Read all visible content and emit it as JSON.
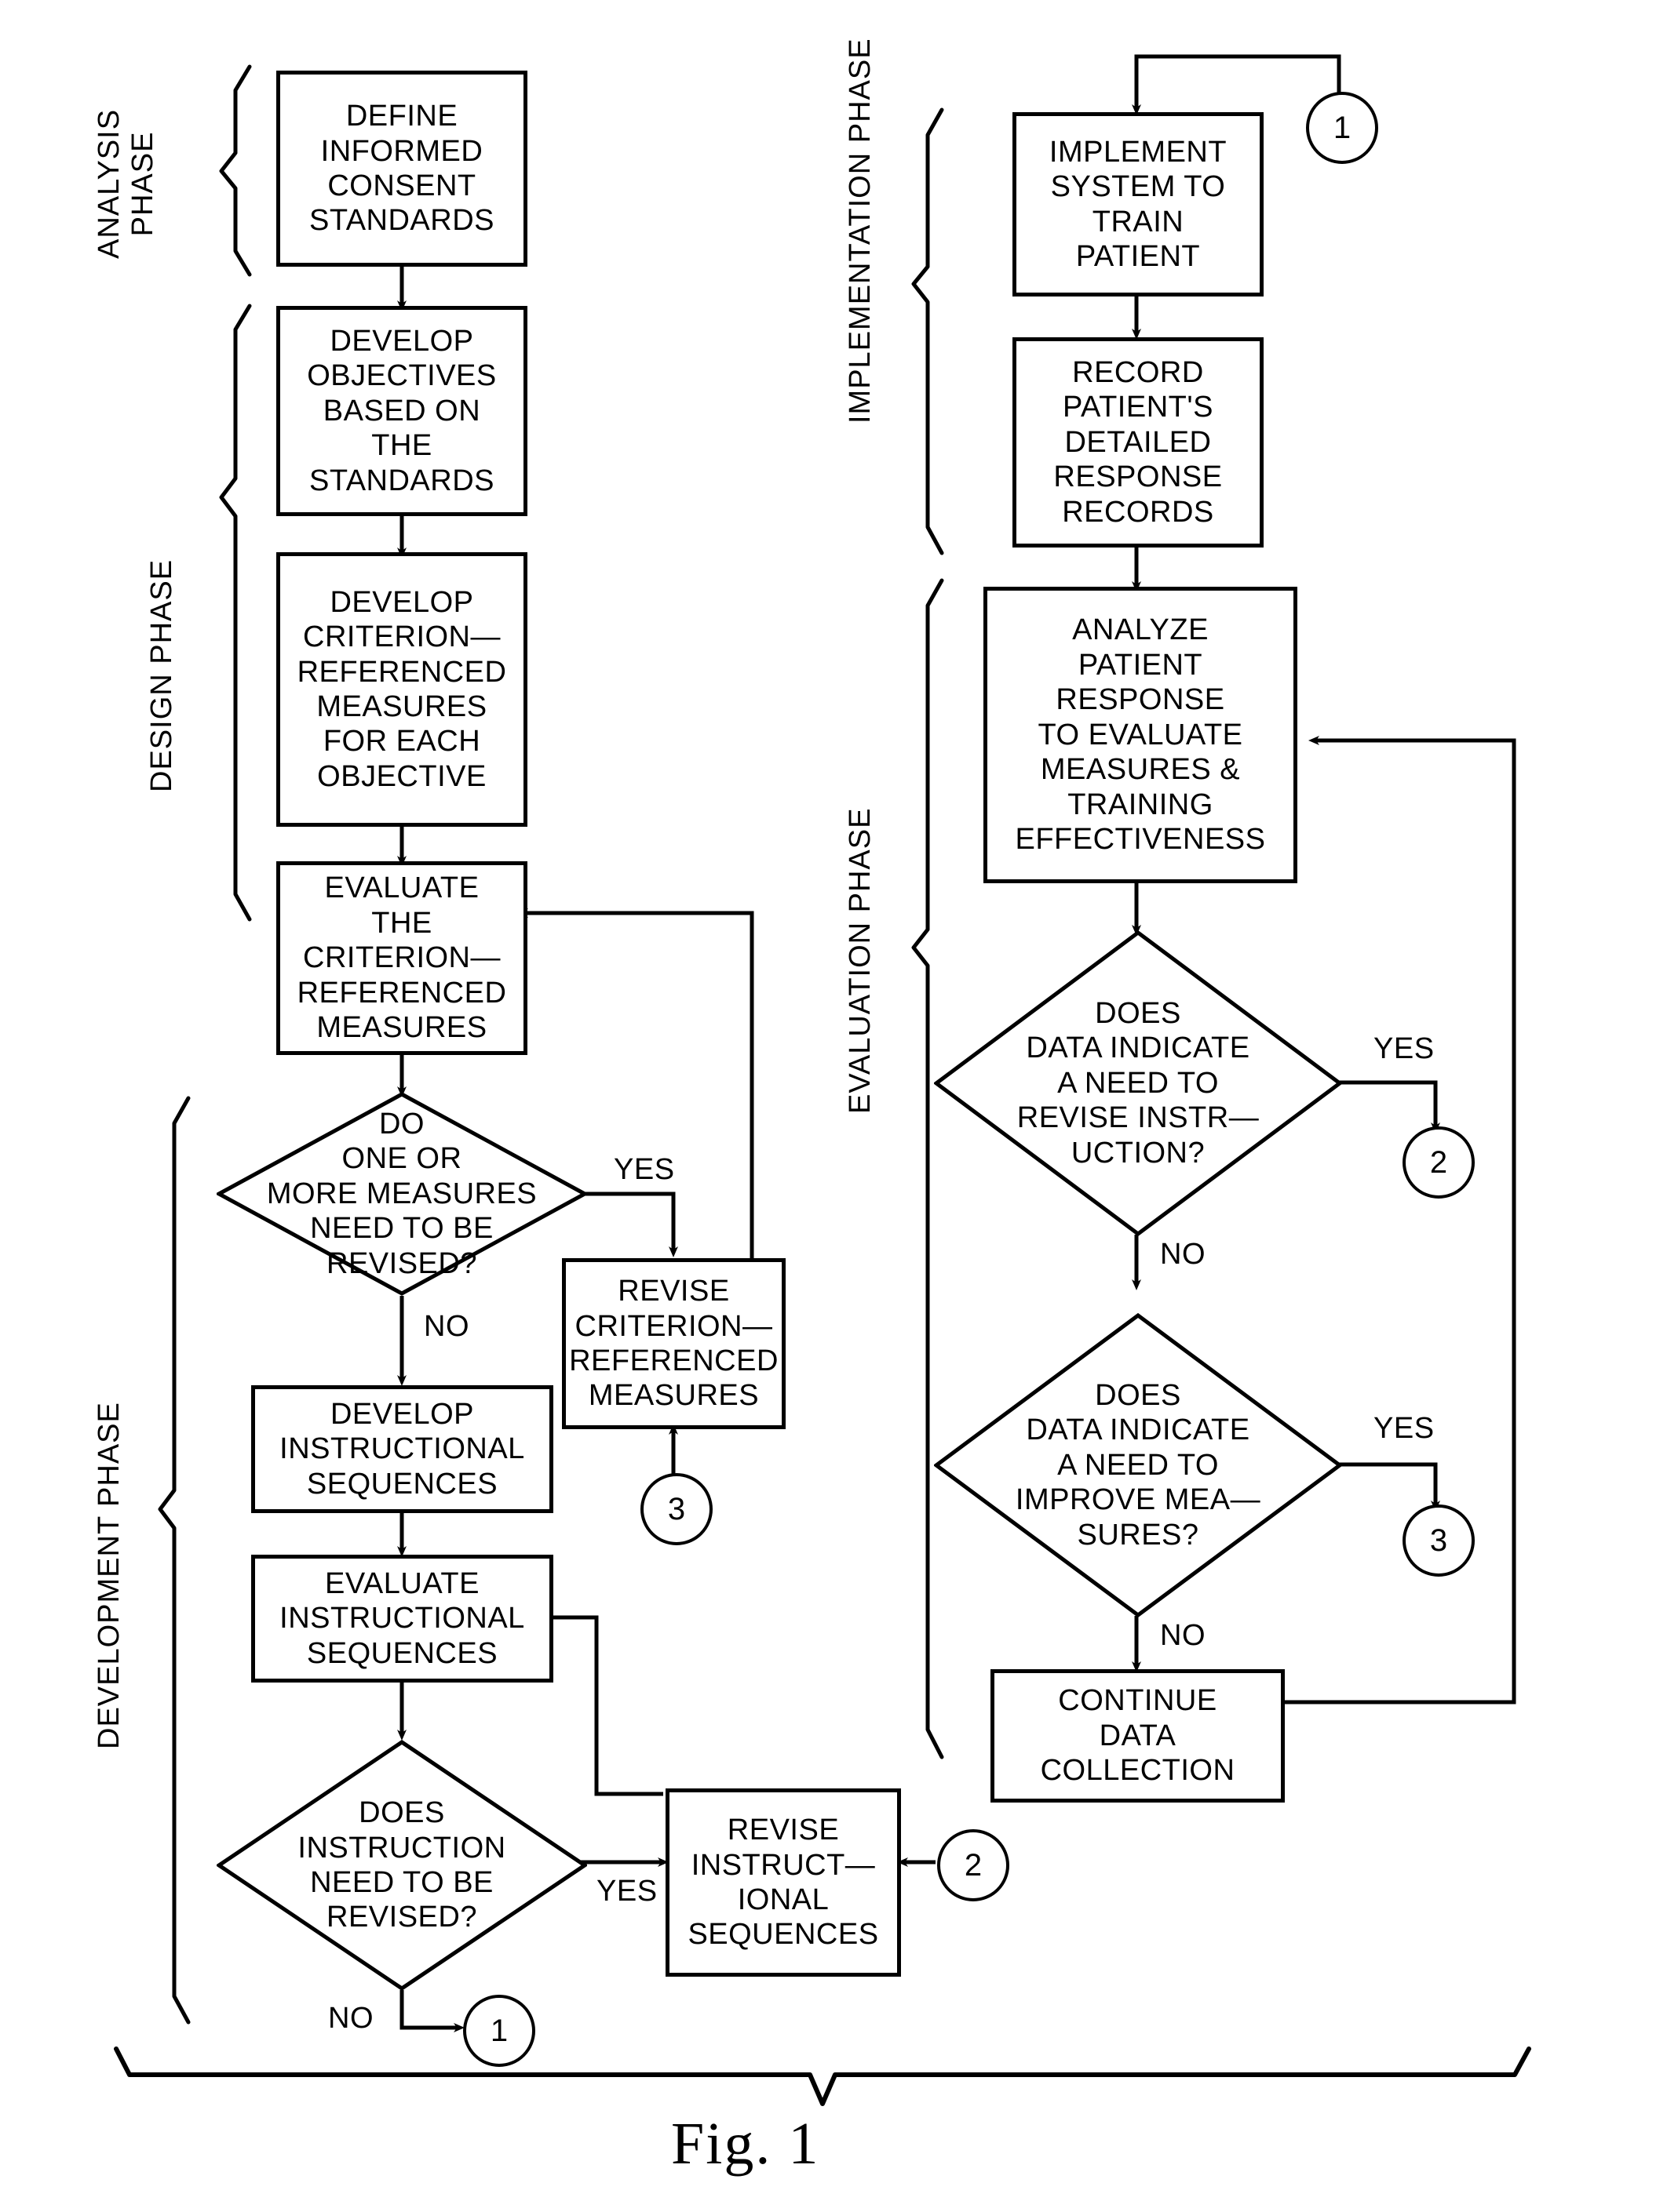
{
  "figure": {
    "caption": "Fig. 1"
  },
  "phases": [
    {
      "id": "analysis",
      "label": "ANALYSIS\nPHASE"
    },
    {
      "id": "design",
      "label": "DESIGN PHASE"
    },
    {
      "id": "development",
      "label": "DEVELOPMENT PHASE"
    },
    {
      "id": "implementation",
      "label": "IMPLEMENTATION PHASE"
    },
    {
      "id": "evaluation",
      "label": "EVALUATION PHASE"
    }
  ],
  "nodes": {
    "define_standards": {
      "type": "process",
      "text": "DEFINE\nINFORMED\nCONSENT\nSTANDARDS"
    },
    "develop_objectives": {
      "type": "process",
      "text": "DEVELOP\nOBJECTIVES\nBASED ON\nTHE\nSTANDARDS"
    },
    "develop_measures": {
      "type": "process",
      "text": "DEVELOP\nCRITERION—\nREFERENCED\nMEASURES\nFOR EACH\nOBJECTIVE"
    },
    "evaluate_measures": {
      "type": "process",
      "text": "EVALUATE\nTHE\nCRITERION—\nREFERENCED\nMEASURES"
    },
    "measures_revise_q": {
      "type": "decision",
      "text": "DO\nONE OR\nMORE MEASURES\nNEED TO BE\nREVISED?"
    },
    "revise_measures": {
      "type": "process",
      "text": "REVISE\nCRITERION—\nREFERENCED\nMEASURES"
    },
    "develop_sequences": {
      "type": "process",
      "text": "DEVELOP\nINSTRUCTIONAL\nSEQUENCES"
    },
    "evaluate_sequences": {
      "type": "process",
      "text": "EVALUATE\nINSTRUCTIONAL\nSEQUENCES"
    },
    "instruction_revise_q": {
      "type": "decision",
      "text": "DOES\nINSTRUCTION\nNEED TO BE\nREVISED?"
    },
    "revise_sequences": {
      "type": "process",
      "text": "REVISE\nINSTRUCT—\nIONAL\nSEQUENCES"
    },
    "implement_system": {
      "type": "process",
      "text": "IMPLEMENT\nSYSTEM TO\nTRAIN\nPATIENT"
    },
    "record_response": {
      "type": "process",
      "text": "RECORD\nPATIENT'S\nDETAILED\nRESPONSE\nRECORDS"
    },
    "analyze_response": {
      "type": "process",
      "text": "ANALYZE\nPATIENT\nRESPONSE\nTO EVALUATE\nMEASURES &\nTRAINING\nEFFECTIVENESS"
    },
    "revise_instruction_q": {
      "type": "decision",
      "text": "DOES\nDATA INDICATE\nA NEED TO\nREVISE INSTR—\nUCTION?"
    },
    "improve_measures_q": {
      "type": "decision",
      "text": "DOES\nDATA INDICATE\nA NEED TO\nIMPROVE MEA—\nSURES?"
    },
    "continue_collection": {
      "type": "process",
      "text": "CONTINUE\nDATA\nCOLLECTION"
    }
  },
  "connector_labels": {
    "measures_yes": "YES",
    "measures_no": "NO",
    "instruction_yes": "YES",
    "instruction_no": "NO",
    "revise_instruction_yes": "YES",
    "revise_instruction_no": "NO",
    "improve_measures_yes": "YES",
    "improve_measures_no": "NO"
  },
  "offpage_connectors": {
    "c1_top_right": "1",
    "c1_bottom_left": "1",
    "c2_right": "2",
    "c2_bottom_left": "2",
    "c3_left": "3",
    "c3_right": "3"
  },
  "chart_data": {
    "type": "diagram",
    "title": "Fig. 1",
    "diagram_kind": "flowchart",
    "edges": [
      {
        "from": "define_standards",
        "to": "develop_objectives"
      },
      {
        "from": "develop_objectives",
        "to": "develop_measures"
      },
      {
        "from": "develop_measures",
        "to": "evaluate_measures"
      },
      {
        "from": "evaluate_measures",
        "to": "measures_revise_q"
      },
      {
        "from": "measures_revise_q",
        "to": "revise_measures",
        "label": "YES"
      },
      {
        "from": "measures_revise_q",
        "to": "develop_sequences",
        "label": "NO"
      },
      {
        "from": "revise_measures",
        "to": "evaluate_measures"
      },
      {
        "from": "develop_sequences",
        "to": "evaluate_sequences"
      },
      {
        "from": "evaluate_sequences",
        "to": "instruction_revise_q"
      },
      {
        "from": "instruction_revise_q",
        "to": "revise_sequences",
        "label": "YES"
      },
      {
        "from": "instruction_revise_q",
        "to": "c1_bottom_left",
        "label": "NO"
      },
      {
        "from": "revise_sequences",
        "to": "evaluate_sequences"
      },
      {
        "from": "c1_top_right",
        "to": "implement_system"
      },
      {
        "from": "implement_system",
        "to": "record_response"
      },
      {
        "from": "record_response",
        "to": "analyze_response"
      },
      {
        "from": "analyze_response",
        "to": "revise_instruction_q"
      },
      {
        "from": "revise_instruction_q",
        "to": "c2_right",
        "label": "YES"
      },
      {
        "from": "revise_instruction_q",
        "to": "improve_measures_q",
        "label": "NO"
      },
      {
        "from": "improve_measures_q",
        "to": "c3_right",
        "label": "YES"
      },
      {
        "from": "improve_measures_q",
        "to": "continue_collection",
        "label": "NO"
      },
      {
        "from": "continue_collection",
        "to": "analyze_response"
      },
      {
        "from": "c3_left",
        "to": "revise_measures"
      },
      {
        "from": "c2_bottom_left",
        "to": "revise_sequences"
      }
    ]
  }
}
